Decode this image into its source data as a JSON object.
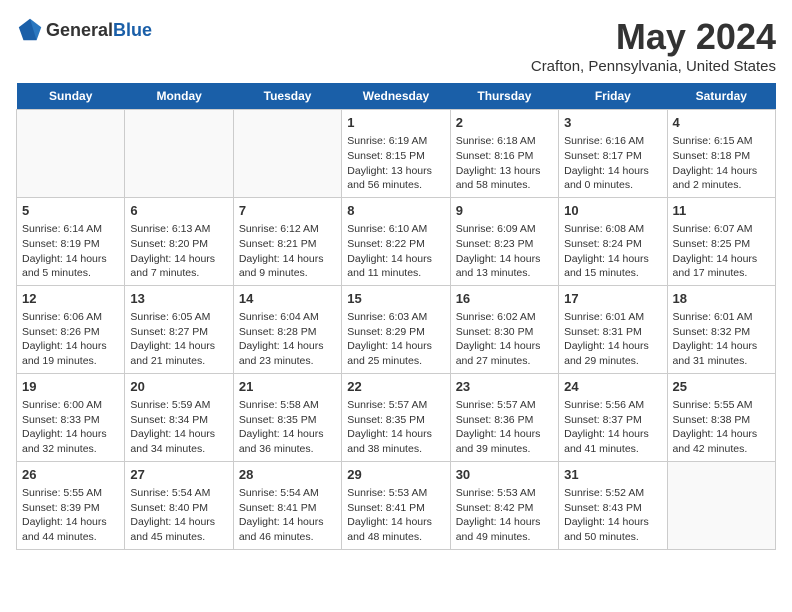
{
  "header": {
    "logo_general": "General",
    "logo_blue": "Blue",
    "title": "May 2024",
    "subtitle": "Crafton, Pennsylvania, United States"
  },
  "days_of_week": [
    "Sunday",
    "Monday",
    "Tuesday",
    "Wednesday",
    "Thursday",
    "Friday",
    "Saturday"
  ],
  "weeks": [
    [
      {
        "day": "",
        "content": ""
      },
      {
        "day": "",
        "content": ""
      },
      {
        "day": "",
        "content": ""
      },
      {
        "day": "1",
        "content": "Sunrise: 6:19 AM\nSunset: 8:15 PM\nDaylight: 13 hours and 56 minutes."
      },
      {
        "day": "2",
        "content": "Sunrise: 6:18 AM\nSunset: 8:16 PM\nDaylight: 13 hours and 58 minutes."
      },
      {
        "day": "3",
        "content": "Sunrise: 6:16 AM\nSunset: 8:17 PM\nDaylight: 14 hours and 0 minutes."
      },
      {
        "day": "4",
        "content": "Sunrise: 6:15 AM\nSunset: 8:18 PM\nDaylight: 14 hours and 2 minutes."
      }
    ],
    [
      {
        "day": "5",
        "content": "Sunrise: 6:14 AM\nSunset: 8:19 PM\nDaylight: 14 hours and 5 minutes."
      },
      {
        "day": "6",
        "content": "Sunrise: 6:13 AM\nSunset: 8:20 PM\nDaylight: 14 hours and 7 minutes."
      },
      {
        "day": "7",
        "content": "Sunrise: 6:12 AM\nSunset: 8:21 PM\nDaylight: 14 hours and 9 minutes."
      },
      {
        "day": "8",
        "content": "Sunrise: 6:10 AM\nSunset: 8:22 PM\nDaylight: 14 hours and 11 minutes."
      },
      {
        "day": "9",
        "content": "Sunrise: 6:09 AM\nSunset: 8:23 PM\nDaylight: 14 hours and 13 minutes."
      },
      {
        "day": "10",
        "content": "Sunrise: 6:08 AM\nSunset: 8:24 PM\nDaylight: 14 hours and 15 minutes."
      },
      {
        "day": "11",
        "content": "Sunrise: 6:07 AM\nSunset: 8:25 PM\nDaylight: 14 hours and 17 minutes."
      }
    ],
    [
      {
        "day": "12",
        "content": "Sunrise: 6:06 AM\nSunset: 8:26 PM\nDaylight: 14 hours and 19 minutes."
      },
      {
        "day": "13",
        "content": "Sunrise: 6:05 AM\nSunset: 8:27 PM\nDaylight: 14 hours and 21 minutes."
      },
      {
        "day": "14",
        "content": "Sunrise: 6:04 AM\nSunset: 8:28 PM\nDaylight: 14 hours and 23 minutes."
      },
      {
        "day": "15",
        "content": "Sunrise: 6:03 AM\nSunset: 8:29 PM\nDaylight: 14 hours and 25 minutes."
      },
      {
        "day": "16",
        "content": "Sunrise: 6:02 AM\nSunset: 8:30 PM\nDaylight: 14 hours and 27 minutes."
      },
      {
        "day": "17",
        "content": "Sunrise: 6:01 AM\nSunset: 8:31 PM\nDaylight: 14 hours and 29 minutes."
      },
      {
        "day": "18",
        "content": "Sunrise: 6:01 AM\nSunset: 8:32 PM\nDaylight: 14 hours and 31 minutes."
      }
    ],
    [
      {
        "day": "19",
        "content": "Sunrise: 6:00 AM\nSunset: 8:33 PM\nDaylight: 14 hours and 32 minutes."
      },
      {
        "day": "20",
        "content": "Sunrise: 5:59 AM\nSunset: 8:34 PM\nDaylight: 14 hours and 34 minutes."
      },
      {
        "day": "21",
        "content": "Sunrise: 5:58 AM\nSunset: 8:35 PM\nDaylight: 14 hours and 36 minutes."
      },
      {
        "day": "22",
        "content": "Sunrise: 5:57 AM\nSunset: 8:35 PM\nDaylight: 14 hours and 38 minutes."
      },
      {
        "day": "23",
        "content": "Sunrise: 5:57 AM\nSunset: 8:36 PM\nDaylight: 14 hours and 39 minutes."
      },
      {
        "day": "24",
        "content": "Sunrise: 5:56 AM\nSunset: 8:37 PM\nDaylight: 14 hours and 41 minutes."
      },
      {
        "day": "25",
        "content": "Sunrise: 5:55 AM\nSunset: 8:38 PM\nDaylight: 14 hours and 42 minutes."
      }
    ],
    [
      {
        "day": "26",
        "content": "Sunrise: 5:55 AM\nSunset: 8:39 PM\nDaylight: 14 hours and 44 minutes."
      },
      {
        "day": "27",
        "content": "Sunrise: 5:54 AM\nSunset: 8:40 PM\nDaylight: 14 hours and 45 minutes."
      },
      {
        "day": "28",
        "content": "Sunrise: 5:54 AM\nSunset: 8:41 PM\nDaylight: 14 hours and 46 minutes."
      },
      {
        "day": "29",
        "content": "Sunrise: 5:53 AM\nSunset: 8:41 PM\nDaylight: 14 hours and 48 minutes."
      },
      {
        "day": "30",
        "content": "Sunrise: 5:53 AM\nSunset: 8:42 PM\nDaylight: 14 hours and 49 minutes."
      },
      {
        "day": "31",
        "content": "Sunrise: 5:52 AM\nSunset: 8:43 PM\nDaylight: 14 hours and 50 minutes."
      },
      {
        "day": "",
        "content": ""
      }
    ]
  ]
}
